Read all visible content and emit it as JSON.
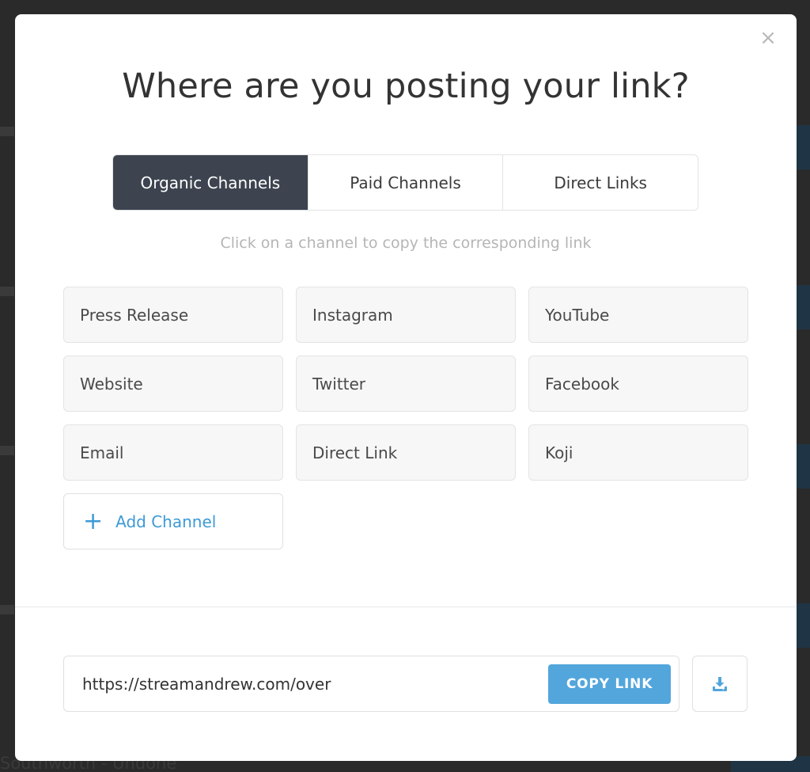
{
  "modal": {
    "title": "Where are you posting your link?",
    "close_glyph": "×",
    "tabs": [
      {
        "label": "Organic Channels",
        "active": true
      },
      {
        "label": "Paid Channels",
        "active": false
      },
      {
        "label": "Direct Links",
        "active": false
      }
    ],
    "hint": "Click on a channel to copy the corresponding link",
    "channels": [
      "Press Release",
      "Instagram",
      "YouTube",
      "Website",
      "Twitter",
      "Facebook",
      "Email",
      "Direct Link",
      "Koji"
    ],
    "add_channel": {
      "icon": "plus-icon",
      "label": "Add Channel"
    },
    "link": {
      "url": "https://streamandrew.com/over",
      "copy_label": "COPY LINK",
      "download_icon": "download-icon"
    }
  },
  "background": {
    "bottom_text": "Southworth - Undone"
  },
  "colors": {
    "accent": "#52a6dc",
    "tab_active_bg": "#3d4450",
    "link_text": "#3d9ad6"
  }
}
